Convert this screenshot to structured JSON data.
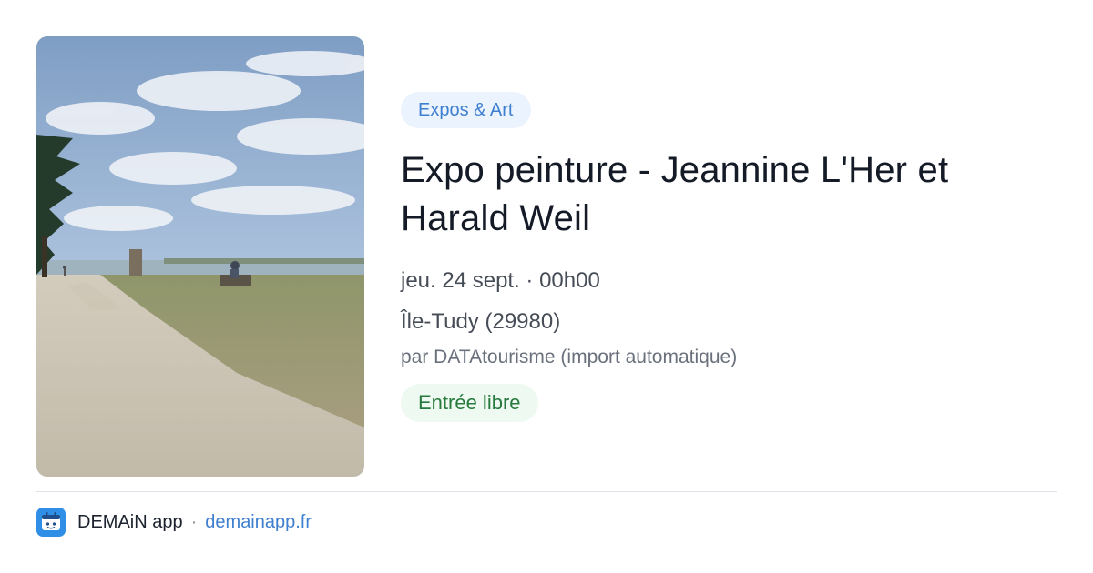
{
  "card": {
    "category": "Expos & Art",
    "title": "Expo peinture - Jeannine L'Her et Harald Weil",
    "date": "jeu. 24 sept. · 00h00",
    "location": "Île-Tudy (29980)",
    "source": "par DATAtourisme (import automatique)",
    "price": "Entrée libre"
  },
  "footer": {
    "app_name": "DEMAiN app",
    "separator": "·",
    "site": "demainapp.fr"
  },
  "colors": {
    "accent": "#3f7fcf",
    "category_bg": "#ebf3fe",
    "price_bg": "#eefaf1",
    "price_text": "#287a3e",
    "title": "#141a26"
  },
  "icons": {
    "logo": "demain-app-logo-icon"
  }
}
